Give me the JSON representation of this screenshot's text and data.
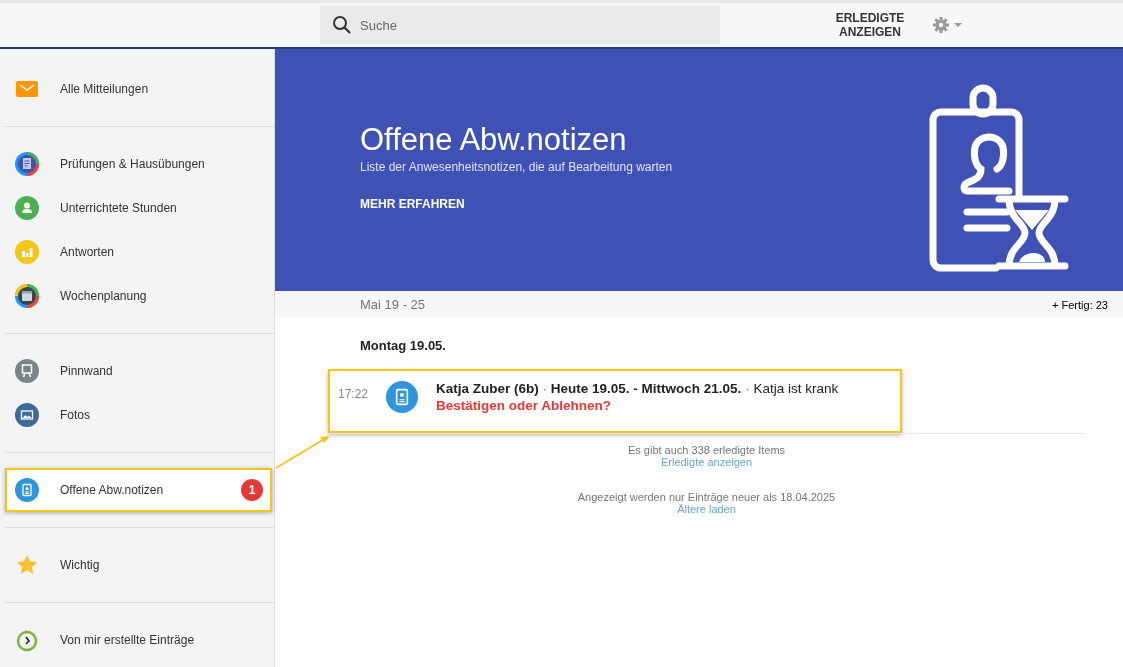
{
  "search": {
    "placeholder": "Suche"
  },
  "toolbar": {
    "show_done_button": "ERLEDIGTE ANZEIGEN"
  },
  "sidebar": {
    "groups": [
      {
        "items": [
          {
            "kind": "mail",
            "label": "Alle Mitteilungen",
            "selected": false
          }
        ]
      },
      {
        "items": [
          {
            "kind": "exams",
            "label": "Prüfungen & Hausübungen",
            "selected": false
          },
          {
            "kind": "lessons",
            "label": "Unterrichtete Stunden",
            "selected": false
          },
          {
            "kind": "answers",
            "label": "Antworten",
            "selected": false
          },
          {
            "kind": "week",
            "label": "Wochenplanung",
            "selected": false
          }
        ]
      },
      {
        "items": [
          {
            "kind": "board",
            "label": "Pinnwand",
            "selected": false
          },
          {
            "kind": "photos",
            "label": "Fotos",
            "selected": false
          }
        ]
      },
      {
        "items": [
          {
            "kind": "absence",
            "label": "Offene Abw.notizen",
            "selected": true,
            "badge": "1"
          }
        ]
      },
      {
        "items": [
          {
            "kind": "star",
            "label": "Wichtig",
            "selected": false
          }
        ]
      },
      {
        "items": [
          {
            "kind": "created",
            "label": "Von mir erstellte Einträge",
            "selected": false
          }
        ]
      }
    ]
  },
  "banner": {
    "title": "Offene Abw.notizen",
    "subtitle": "Liste der Anwesenheitsnotizen, die auf Bearbeitung warten",
    "link": "MEHR ERFAHREN"
  },
  "week_bar": {
    "range": "Mai 19 - 25",
    "done_count": "+ Fertig: 23"
  },
  "days": [
    {
      "heading": "Montag 19.05.",
      "entries": [
        {
          "time": "17:22",
          "highlighted": true,
          "student": "Katja Zuber (6b)",
          "separator": "·",
          "period": "Heute 19.05. - Mittwoch 21.05.",
          "reason": "Katja ist krank",
          "action": "Bestätigen oder Ablehnen?"
        }
      ]
    }
  ],
  "footer": {
    "done_info": "Es gibt auch 338 erledigte Items",
    "done_link": "Erledigte anzeigen",
    "range_info": "Angezeigt werden nur Einträge neuer als 18.04.2025",
    "older_link": "Ältere laden"
  }
}
